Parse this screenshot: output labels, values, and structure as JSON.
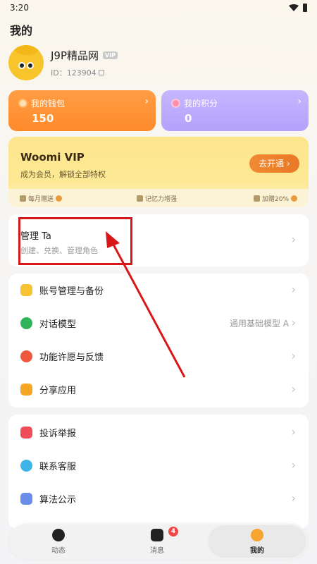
{
  "status": {
    "time": "3:20"
  },
  "page": {
    "title": "我的"
  },
  "profile": {
    "username": "J9P精品网",
    "vip_tag": "VIP",
    "id_text": "ID：123904"
  },
  "wallet": {
    "label": "我的钱包",
    "value": "150"
  },
  "points": {
    "label": "我的积分",
    "value": "0"
  },
  "vip": {
    "title": "Woomi VIP",
    "subtitle": "成为会员，解锁全部特权",
    "button": "去开通",
    "perks": [
      "每月赠送",
      "记忆力增强",
      "加赠20%"
    ]
  },
  "manage": {
    "title": "管理 Ta",
    "subtitle": "创建、兑换、管理角色"
  },
  "menu1": [
    {
      "label": "账号管理与备份",
      "value": "",
      "icon": "account-icon"
    },
    {
      "label": "对话模型",
      "value": "通用基础模型 A",
      "icon": "chat-model-icon"
    },
    {
      "label": "功能许愿与反馈",
      "value": "",
      "icon": "heart-icon"
    },
    {
      "label": "分享应用",
      "value": "",
      "icon": "share-icon"
    }
  ],
  "menu2": [
    {
      "label": "投诉举报",
      "icon": "report-icon"
    },
    {
      "label": "联系客服",
      "icon": "support-icon"
    },
    {
      "label": "算法公示",
      "icon": "algorithm-icon"
    }
  ],
  "tabs": [
    {
      "label": "动态",
      "icon": "moments-icon"
    },
    {
      "label": "消息",
      "icon": "message-icon",
      "badge": "4"
    },
    {
      "label": "我的",
      "icon": "me-icon",
      "active": true
    }
  ],
  "colors": {
    "wallet": "#ff8f33",
    "points": "#b9a8fd",
    "vip_card": "#fde58c",
    "vip_button": "#ec8029",
    "annotation": "#d81818",
    "badge": "#f04848"
  }
}
